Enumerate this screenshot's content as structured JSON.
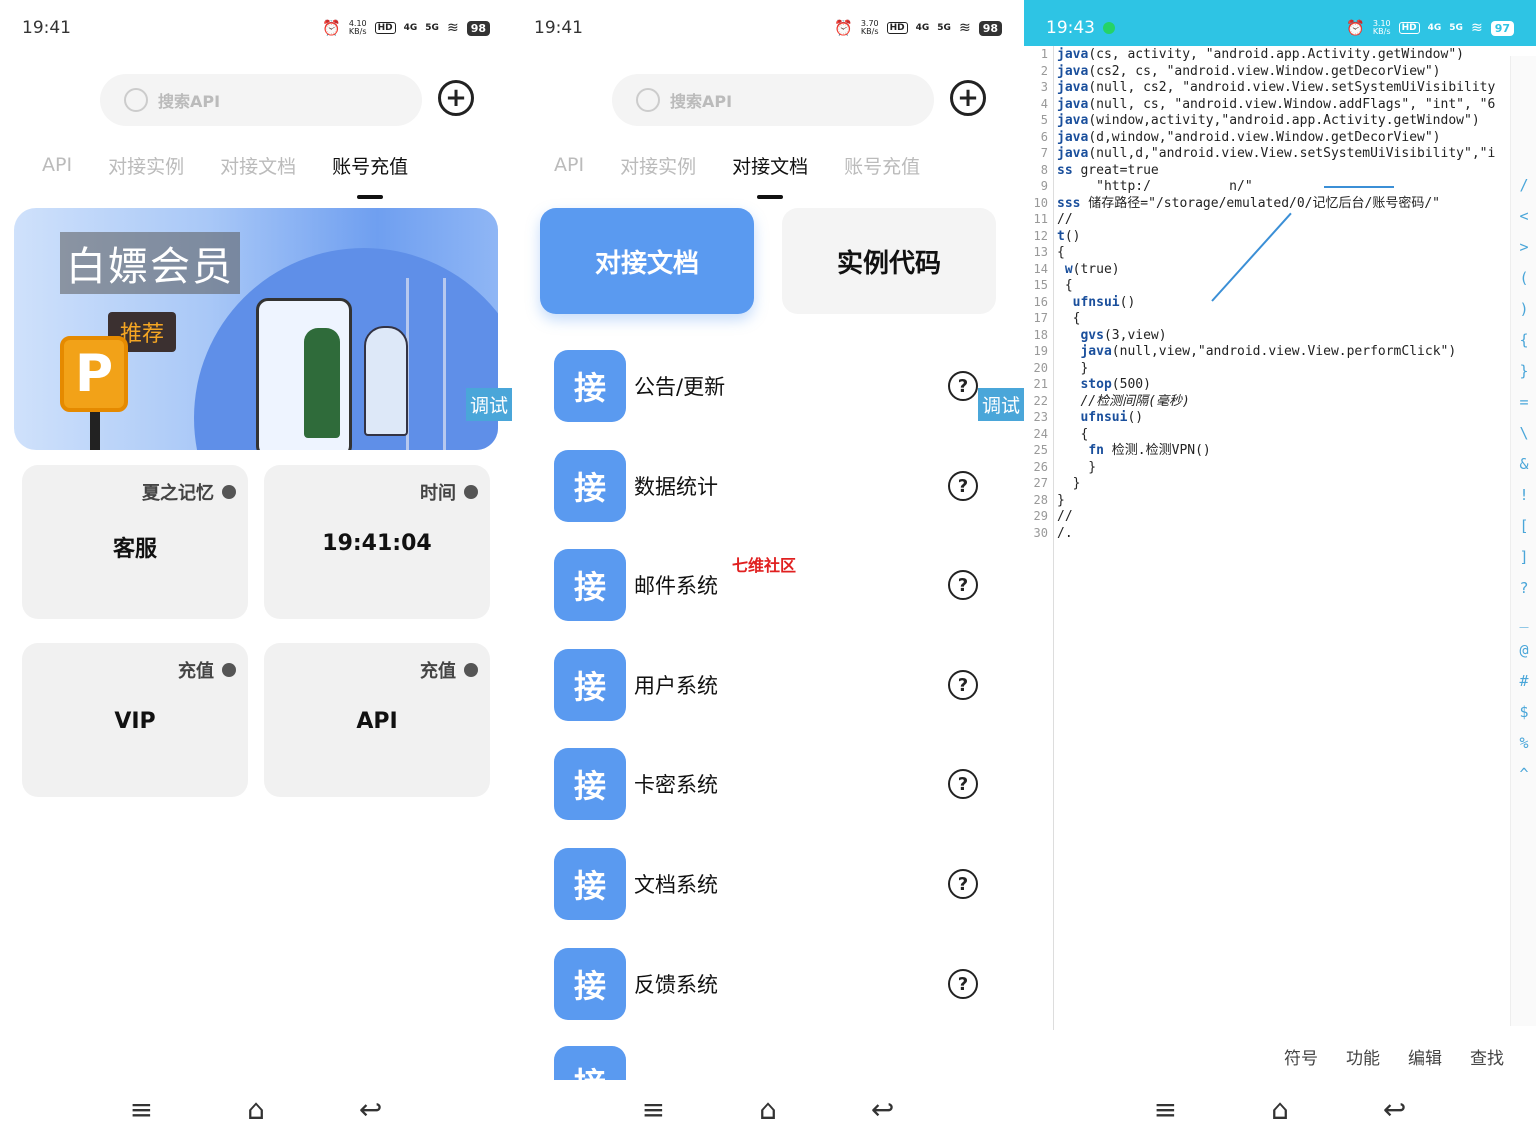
{
  "status": {
    "s1_time": "19:41",
    "s2_time": "19:41",
    "s3_time": "19:43",
    "speed_s1": "4.10",
    "speed_s2": "3.70",
    "speed_s3": "3.10",
    "speed_unit": "KB/s",
    "hd": "HD",
    "sig4": "4G",
    "sig5": "5G",
    "battery_s1": "98",
    "battery_s2": "98",
    "battery_s3": "97"
  },
  "search": {
    "placeholder": "搜索API"
  },
  "tabs": [
    "API",
    "对接实例",
    "对接文档",
    "账号充值"
  ],
  "active_tab_s1": "账号充值",
  "active_tab_s2": "对接文档",
  "banner": {
    "title": "白嫖会员",
    "tag": "推荐",
    "logo": "P"
  },
  "debug_label": "调试",
  "cards": [
    {
      "top": "夏之记忆",
      "main": "客服"
    },
    {
      "top": "时间",
      "main": "19:41:04"
    },
    {
      "top": "充值",
      "main": "VIP"
    },
    {
      "top": "充值",
      "main": "API"
    }
  ],
  "doc_buttons": {
    "primary": "对接文档",
    "secondary": "实例代码"
  },
  "api_badge": "接",
  "api_items": [
    "公告/更新",
    "数据统计",
    "邮件系统",
    "用户系统",
    "卡密系统",
    "文档系统",
    "反馈系统"
  ],
  "help_glyph": "?",
  "watermark": "七维社区",
  "code_lines": [
    "java(cs, activity, \"android.app.Activity.getWindow\")",
    "java(cs2, cs, \"android.view.Window.getDecorView\")",
    "java(null, cs2, \"android.view.View.setSystemUiVisibility",
    "java(null, cs, \"android.view.Window.addFlags\", \"int\", \"6",
    "java(window,activity,\"android.app.Activity.getWindow\")",
    "java(d,window,\"android.view.Window.getDecorView\")",
    "java(null,d,\"android.view.View.setSystemUiVisibility\",\"i",
    "ss great=true",
    "     \"http:/          n/\"",
    "sss 储存路径=\"/storage/emulated/0/记忆后台/账号密码/\"",
    "//",
    "t()",
    "{",
    " w(true)",
    " {",
    "  ufnsui()",
    "  {",
    "   gvs(3,view)",
    "   java(null,view,\"android.view.View.performClick\")",
    "   }",
    "   stop(500)",
    "   //检测间隔(毫秒)",
    "   ufnsui()",
    "   {",
    "    fn 检测.检测VPN()",
    "    }",
    "  }",
    "}",
    "//",
    "/."
  ],
  "side_symbols": [
    "/",
    "<",
    ">",
    "(",
    ")",
    "{",
    "}",
    "=",
    "\\",
    "&",
    "!",
    "[",
    "]",
    "?",
    "_",
    "@",
    "#",
    "$",
    "%",
    "^"
  ],
  "editor_toolbar": [
    "符号",
    "功能",
    "编辑",
    "查找"
  ],
  "nav": {
    "menu": "≡",
    "home": "⌂",
    "back": "↩"
  },
  "colors": {
    "primary": "#5a9af0",
    "editor_bar": "#2ec4e4",
    "debug": "#4aa6d9"
  }
}
